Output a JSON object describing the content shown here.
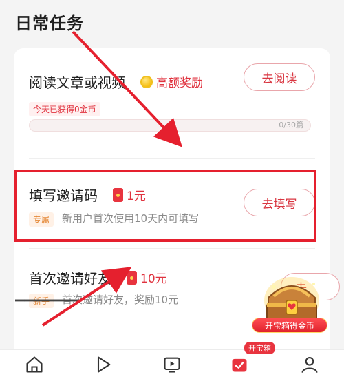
{
  "page": {
    "title": "日常任务"
  },
  "tasks": [
    {
      "title": "阅读文章或视频",
      "reward_icon": "coin-icon",
      "reward_text": "高额奖励",
      "progress_caption": "今天已获得0金币",
      "progress_value": 0,
      "progress_max": 30,
      "progress_label": "0/30篇",
      "button_label": "去阅读"
    },
    {
      "title": "填写邀请码",
      "reward_icon": "red-packet-icon",
      "reward_text": "1元",
      "tag": "专属",
      "description": "新用户首次使用10天内可填写",
      "button_label": "去填写"
    },
    {
      "title": "首次邀请好友",
      "reward_icon": "red-packet-icon",
      "reward_text": "10元",
      "tag": "新手",
      "description": "首次邀请好友，奖励10元",
      "button_label": "去"
    }
  ],
  "treasure_chest": {
    "label": "开宝箱得金币"
  },
  "bottom_nav": {
    "badge": "开宝箱",
    "items": [
      {
        "icon": "home-icon"
      },
      {
        "icon": "video-play-icon"
      },
      {
        "icon": "tv-icon"
      },
      {
        "icon": "task-check-icon"
      },
      {
        "icon": "user-icon"
      }
    ]
  },
  "colors": {
    "accent": "#e0333f",
    "highlight": "#e5202e",
    "background": "#f4f4f4"
  }
}
